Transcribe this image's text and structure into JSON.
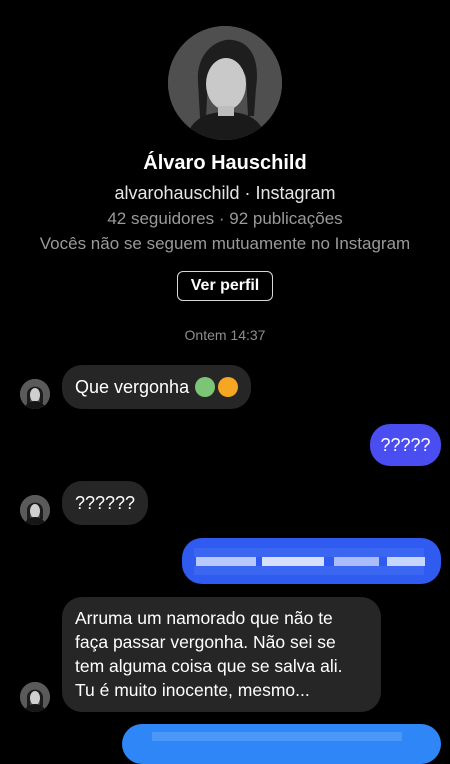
{
  "profile": {
    "name": "Álvaro Hauschild",
    "handle_line": "alvarohauschild · Instagram",
    "stats": "42 seguidores · 92 publicações",
    "mutual": "Vocês não se seguem mutuamente no Instagram",
    "view_profile_label": "Ver perfil"
  },
  "conversation": {
    "timestamp": "Ontem 14:37",
    "messages": [
      {
        "from": "them",
        "text": "Que vergonha",
        "emojis": [
          "nauseated-face",
          "vomiting-face"
        ]
      },
      {
        "from": "me",
        "text": "?????"
      },
      {
        "from": "them",
        "text": "??????"
      },
      {
        "from": "me",
        "text": "",
        "note": "blurred"
      },
      {
        "from": "them",
        "lines": [
          "Arruma um namorado que não te",
          "faça passar vergonha. Não sei se",
          "tem alguma coisa que se salva ali.",
          "Tu é muito inocente, mesmo..."
        ]
      },
      {
        "from": "me",
        "text": "",
        "note": "blurred"
      }
    ]
  },
  "colors": {
    "outgoing_bubble": "#4a4df0",
    "outgoing_bubble_alt": "#2f86f6",
    "incoming_bubble": "#262626",
    "secondary_text": "#9a9a9a"
  }
}
